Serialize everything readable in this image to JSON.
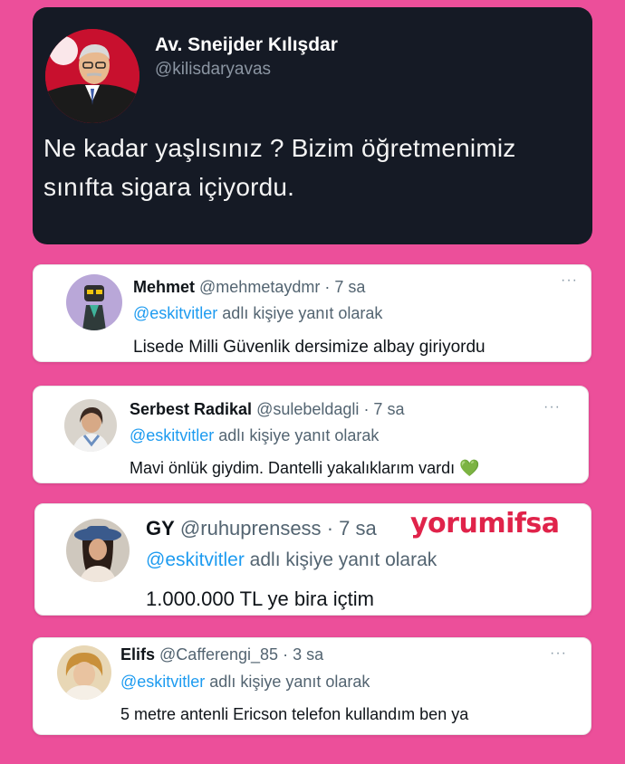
{
  "main_tweet": {
    "name": "Av. Sneijder Kılışdar",
    "handle": "@kilisdaryavas",
    "text": "Ne kadar yaşlısınız ? Bizim öğretmenimiz sınıfta sigara içiyordu."
  },
  "replies": [
    {
      "name": "Mehmet",
      "handle": "@mehmetaydmr",
      "time": "· 7 sa",
      "reply_mention": "@eskitvitler",
      "reply_suffix": " adlı kişiye yanıt olarak",
      "text": "Lisede Milli Güvenlik dersimize albay giriyordu"
    },
    {
      "name": "Serbest Radikal",
      "handle": "@sulebeldagli",
      "time": "· 7 sa",
      "reply_mention": "@eskitvitler",
      "reply_suffix": " adlı kişiye yanıt olarak",
      "text": "Mavi önlük giydim. Dantelli yakalıklarım vardı",
      "emoji": "💚"
    },
    {
      "name": "GY",
      "handle": "@ruhuprensess",
      "time": "· 7 sa",
      "overlay": "yorumifsa",
      "reply_mention": "@eskitvitler",
      "reply_suffix": " adlı kişiye yanıt olarak",
      "text": "1.000.000 TL ye bira içtim"
    },
    {
      "name": "Elifs",
      "handle": "@Cafferengi_85",
      "time": "· 3 sa",
      "reply_mention": "@eskitvitler",
      "reply_suffix": " adlı kişiye yanıt olarak",
      "text": "5 metre antenli Ericson telefon kullandım ben ya"
    }
  ],
  "more_icon": "···",
  "colors": {
    "background": "#ec4f9a",
    "dark_card": "#151a25",
    "mention": "#1d9bf0",
    "overlay_red": "#e0234a"
  }
}
